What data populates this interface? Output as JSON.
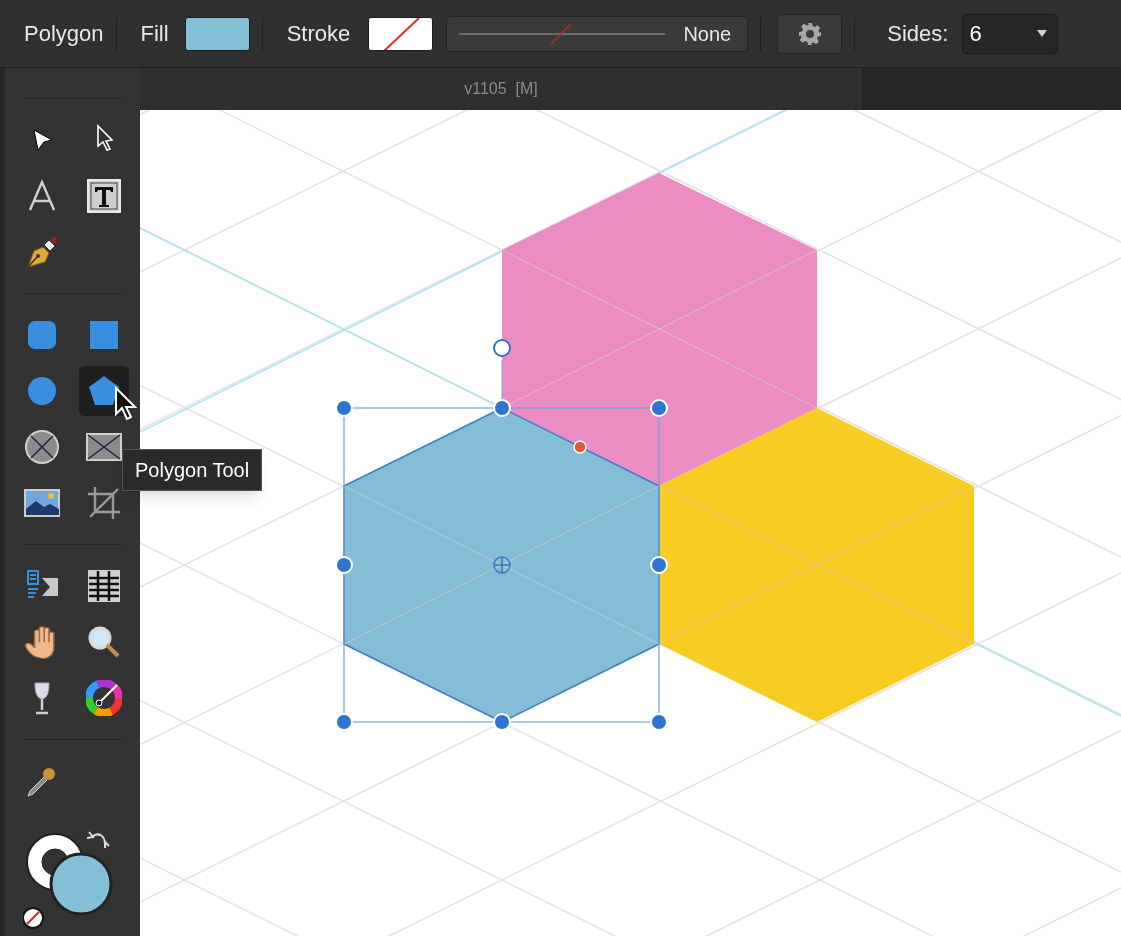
{
  "context_toolbar": {
    "tool_name": "Polygon",
    "fill_label": "Fill",
    "stroke_label": "Stroke",
    "line_style": "None",
    "sides_label": "Sides:",
    "sides_value": "6"
  },
  "document_tab": {
    "title": "v1105  [M]"
  },
  "tool_groups": [
    {
      "tools": [
        {
          "kind": "move",
          "selected": false
        },
        {
          "kind": "node",
          "selected": false
        },
        {
          "kind": "artistic-text",
          "selected": false
        },
        {
          "kind": "frame-text",
          "selected": false
        },
        {
          "kind": "pen",
          "selected": false
        }
      ]
    },
    {
      "tools": [
        {
          "kind": "rounded-rect",
          "selected": false
        },
        {
          "kind": "rect",
          "selected": false
        },
        {
          "kind": "ellipse",
          "selected": false
        },
        {
          "kind": "polygon",
          "selected": true
        },
        {
          "kind": "ellipse-frame",
          "selected": false
        },
        {
          "kind": "rect-frame",
          "selected": false
        },
        {
          "kind": "picture",
          "selected": false
        },
        {
          "kind": "crop",
          "selected": false
        }
      ]
    },
    {
      "tools": [
        {
          "kind": "text-flow",
          "selected": false
        },
        {
          "kind": "table",
          "selected": false
        },
        {
          "kind": "hand",
          "selected": false
        },
        {
          "kind": "zoom",
          "selected": false
        },
        {
          "kind": "transparency",
          "selected": false
        },
        {
          "kind": "color-wheel",
          "selected": false
        }
      ]
    },
    {
      "tools": [
        {
          "kind": "eyedropper",
          "selected": false
        }
      ]
    }
  ],
  "tooltip": {
    "text": "Polygon Tool"
  }
}
